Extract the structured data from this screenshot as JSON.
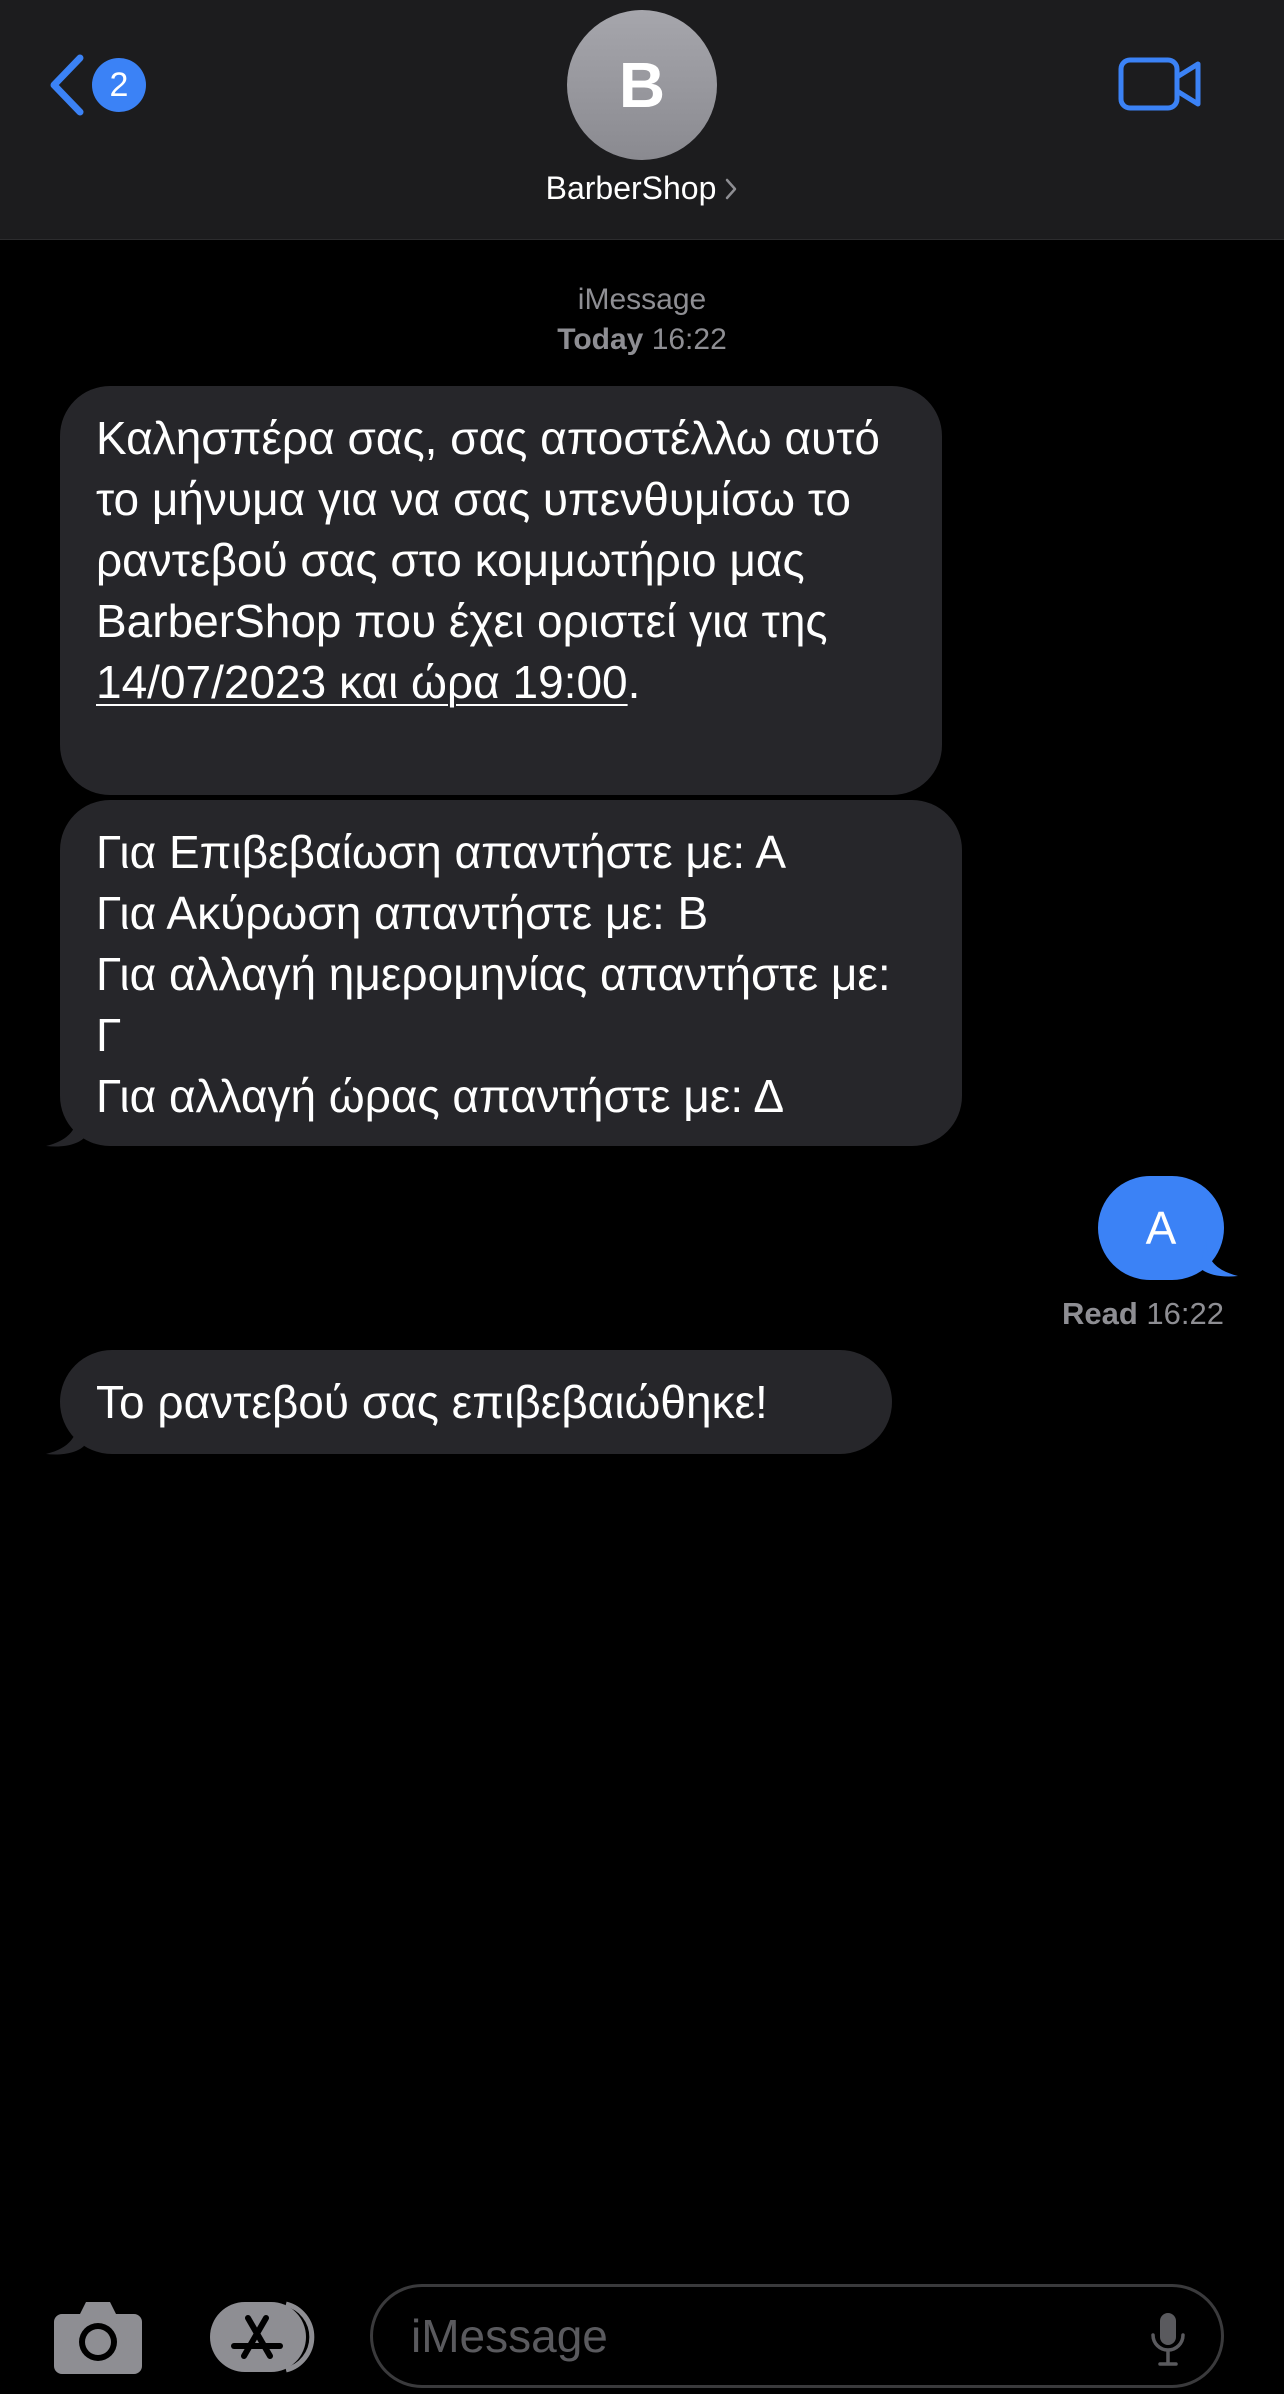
{
  "header": {
    "back_badge_count": "2",
    "avatar_initial": "B",
    "contact_name": "BarberShop"
  },
  "thread": {
    "service": "iMessage",
    "day": "Today",
    "time": "16:22"
  },
  "messages": [
    {
      "direction": "incoming",
      "text_before_link": "Καλησπέρα σας, σας αποστέλλω αυτό το μήνυμα για να σας υπενθυμίσω το ραντεβού σας στο κομμωτήριο μας BarberShop που έχει οριστεί για της ",
      "link_text": "14/07/2023 και ώρα 19:00",
      "text_after_link": "."
    },
    {
      "direction": "incoming",
      "lines": [
        "Για Επιβεβαίωση απαντήστε με: Α",
        "Για Ακύρωση απαντήστε με: Β",
        "Για αλλαγή ημερομηνίας απαντήστε με: Γ",
        "Για αλλαγή ώρας απαντήστε με: Δ"
      ]
    },
    {
      "direction": "outgoing",
      "text": "A"
    },
    {
      "direction": "incoming",
      "text": "Το ραντεβού σας επιβεβαιώθηκε!"
    }
  ],
  "read_receipt": {
    "label": "Read",
    "time": "16:22"
  },
  "input": {
    "placeholder": "iMessage"
  },
  "colors": {
    "accent": "#3b82f6",
    "incoming_bubble": "#26262a",
    "header_bg": "#1c1c1e",
    "secondary_text": "#8e8e93"
  },
  "icons": [
    "chevron-left-icon",
    "video-camera-icon",
    "chevron-right-icon",
    "camera-icon",
    "app-store-icon",
    "microphone-icon"
  ]
}
